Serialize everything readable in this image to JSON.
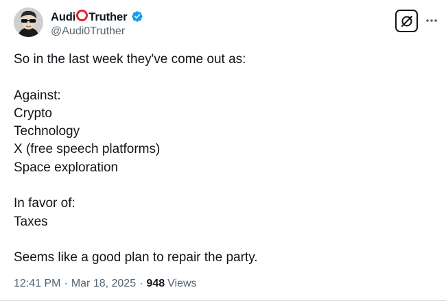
{
  "author": {
    "display_name_prefix": "Audi",
    "display_name_suffix": "Truther",
    "handle": "@Audi0Truther",
    "verified": true
  },
  "icons": {
    "avatar": "avatar-person-sunglasses",
    "verified": "verified-badge-icon",
    "grok": "grok-icon",
    "more": "more-options-icon"
  },
  "colors": {
    "verified_blue": "#1d9bf0",
    "name_circle_red": "#e0202a",
    "secondary_text": "#536471"
  },
  "tweet": {
    "lines": [
      "So in the last week they've come out as:",
      "",
      "Against:",
      "Crypto",
      "Technology",
      "X (free speech platforms)",
      "Space exploration",
      "",
      "In favor of:",
      "Taxes",
      "",
      "Seems like a good plan to repair the party."
    ]
  },
  "meta": {
    "time": "12:41 PM",
    "separator": "·",
    "date": "Mar 18, 2025",
    "views_count": "948",
    "views_label": "Views"
  }
}
